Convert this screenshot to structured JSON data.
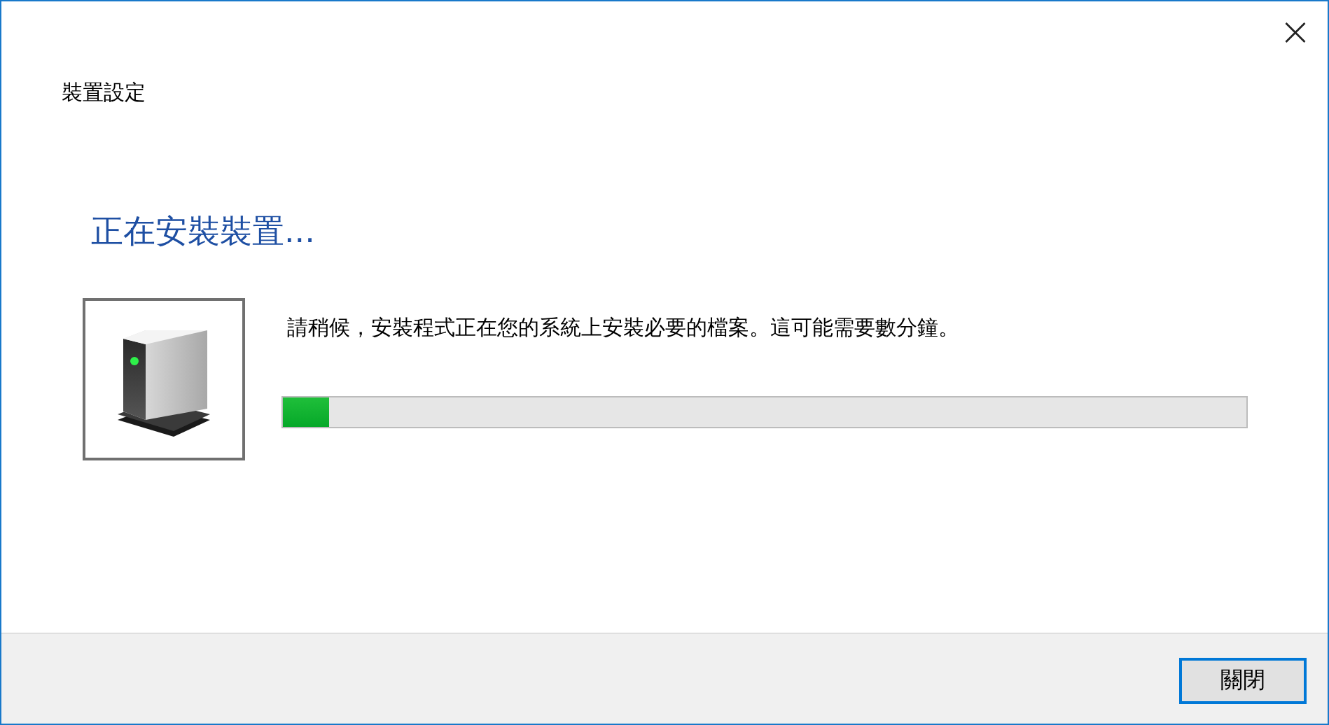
{
  "window": {
    "title": "裝置設定",
    "close": "×"
  },
  "heading": "正在安裝裝置...",
  "message": "請稍候，安裝程式正在您的系統上安裝必要的檔案。這可能需要數分鐘。",
  "progress": {
    "level": 0.048
  },
  "buttons": [
    {
      "label": "關閉",
      "focused": true
    }
  ]
}
